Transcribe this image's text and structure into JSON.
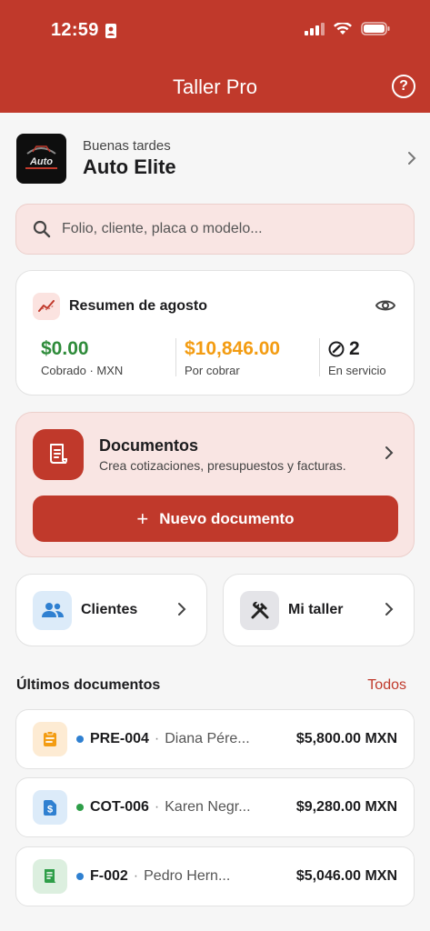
{
  "status": {
    "time": "12:59"
  },
  "header": {
    "title": "Taller Pro",
    "help_label": "?"
  },
  "greeting": {
    "subtitle": "Buenas tardes",
    "name": "Auto Elite",
    "logo_text": "Auto Elite"
  },
  "search": {
    "placeholder": "Folio, cliente, placa o modelo..."
  },
  "summary": {
    "title": "Resumen de agosto",
    "stats": [
      {
        "value": "$0.00",
        "label": "Cobrado · MXN",
        "color": "#2e8b3a"
      },
      {
        "value": "$10,846.00",
        "label": "Por cobrar",
        "color": "#f39c12"
      },
      {
        "value": "2",
        "label": "En servicio",
        "color": "#1c1c1e"
      }
    ]
  },
  "documents": {
    "title": "Documentos",
    "subtitle": "Crea cotizaciones, presupuestos y facturas.",
    "new_button": "Nuevo documento"
  },
  "tiles": [
    {
      "label": "Clientes",
      "icon": "users-icon"
    },
    {
      "label": "Mi taller",
      "icon": "tools-icon"
    }
  ],
  "recent": {
    "title": "Últimos documentos",
    "link": "Todos",
    "rows": [
      {
        "folio": "PRE-004",
        "client": "Diana Pére...",
        "amount": "$5,800.00 MXN",
        "icon": "clipboard-icon",
        "icon_bg": "#fdebd3",
        "icon_color": "#f39c12",
        "dot": "#2f80d1"
      },
      {
        "folio": "COT-006",
        "client": "Karen Negr...",
        "amount": "$9,280.00 MXN",
        "icon": "dollar-doc-icon",
        "icon_bg": "#dcebf9",
        "icon_color": "#2f80d1",
        "dot": "#2e9e48"
      },
      {
        "folio": "F-002",
        "client": "Pedro Hern...",
        "amount": "$5,046.00 MXN",
        "icon": "invoice-icon",
        "icon_bg": "#dcefdf",
        "icon_color": "#2e9e48",
        "dot": "#2f80d1"
      }
    ]
  },
  "colors": {
    "brand": "#c0392b",
    "brand_tint": "#f9e5e3"
  }
}
